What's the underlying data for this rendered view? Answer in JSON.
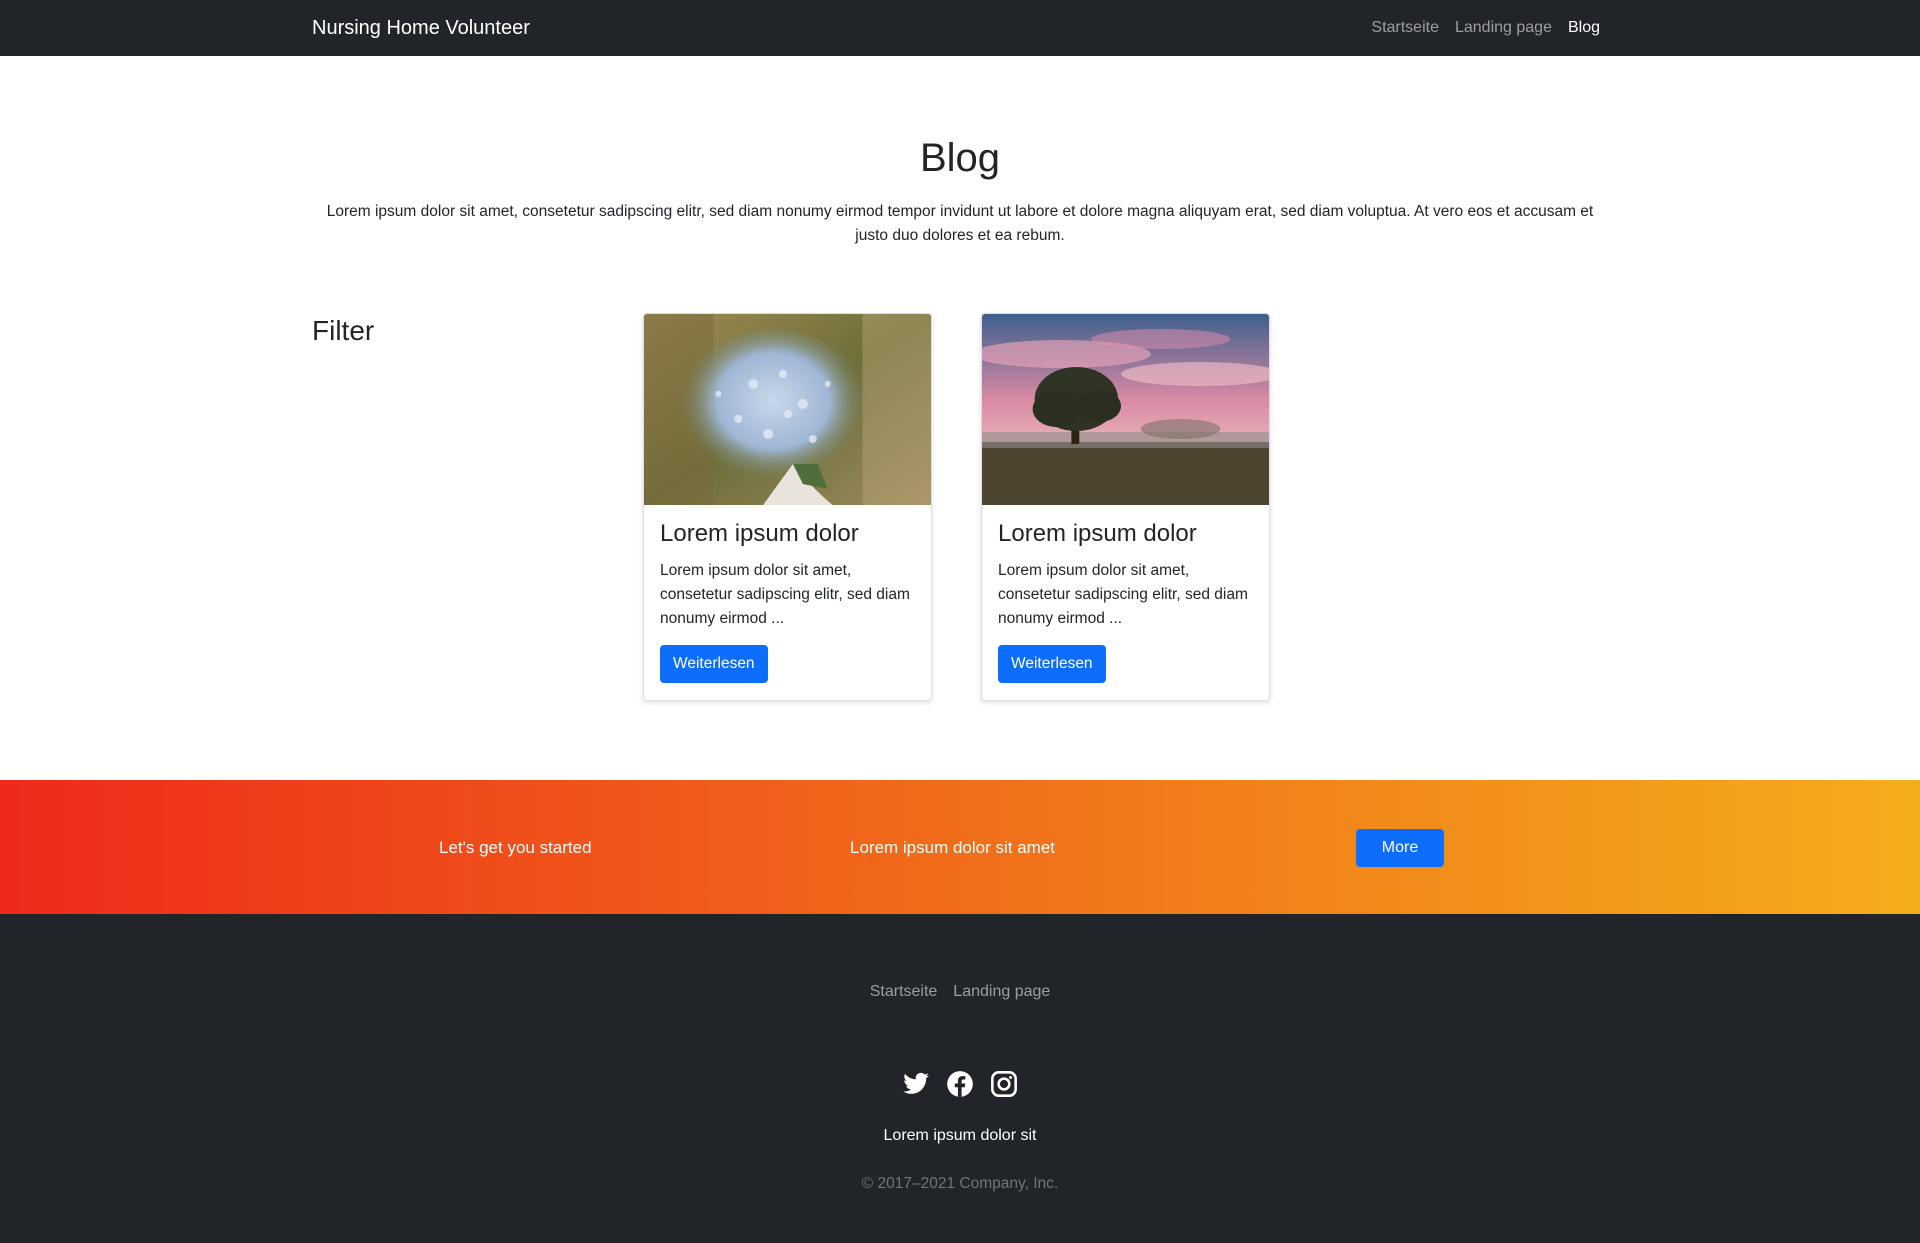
{
  "navbar": {
    "brand": "Nursing Home Volunteer",
    "links": [
      "Startseite",
      "Landing page",
      "Blog"
    ],
    "active": "Blog"
  },
  "hero": {
    "title": "Blog",
    "lead": "Lorem ipsum dolor sit amet, consetetur sadipscing elitr, sed diam nonumy eirmod tempor invidunt ut labore et dolore magna aliquyam erat, sed diam voluptua. At vero eos et accusam et justo duo dolores et ea rebum."
  },
  "filter": {
    "title": "Filter"
  },
  "cards": [
    {
      "image": "bouquet-of-blue-flowers-photo",
      "title": "Lorem ipsum dolor",
      "text": "Lorem ipsum dolor sit amet, consetetur sadipscing elitr, sed diam nonumy eirmod ...",
      "button": "Weiterlesen"
    },
    {
      "image": "tree-in-field-at-sunset-photo",
      "title": "Lorem ipsum dolor",
      "text": "Lorem ipsum dolor sit amet, consetetur sadipscing elitr, sed diam nonumy eirmod ...",
      "button": "Weiterlesen"
    }
  ],
  "cta": {
    "left": "Let's get you started",
    "middle": "Lorem ipsum dolor sit amet",
    "button": "More"
  },
  "footer": {
    "links": [
      "Startseite",
      "Landing page"
    ],
    "social_icons": [
      "twitter-icon",
      "facebook-icon",
      "instagram-icon"
    ],
    "tagline": "Lorem ipsum dolor sit",
    "copyright": "© 2017–2021 Company, Inc."
  },
  "colors": {
    "navbar_bg": "#212529",
    "primary": "#0d6efd",
    "gradient_start": "#ee2a1b",
    "gradient_end": "#f4ad1c"
  }
}
